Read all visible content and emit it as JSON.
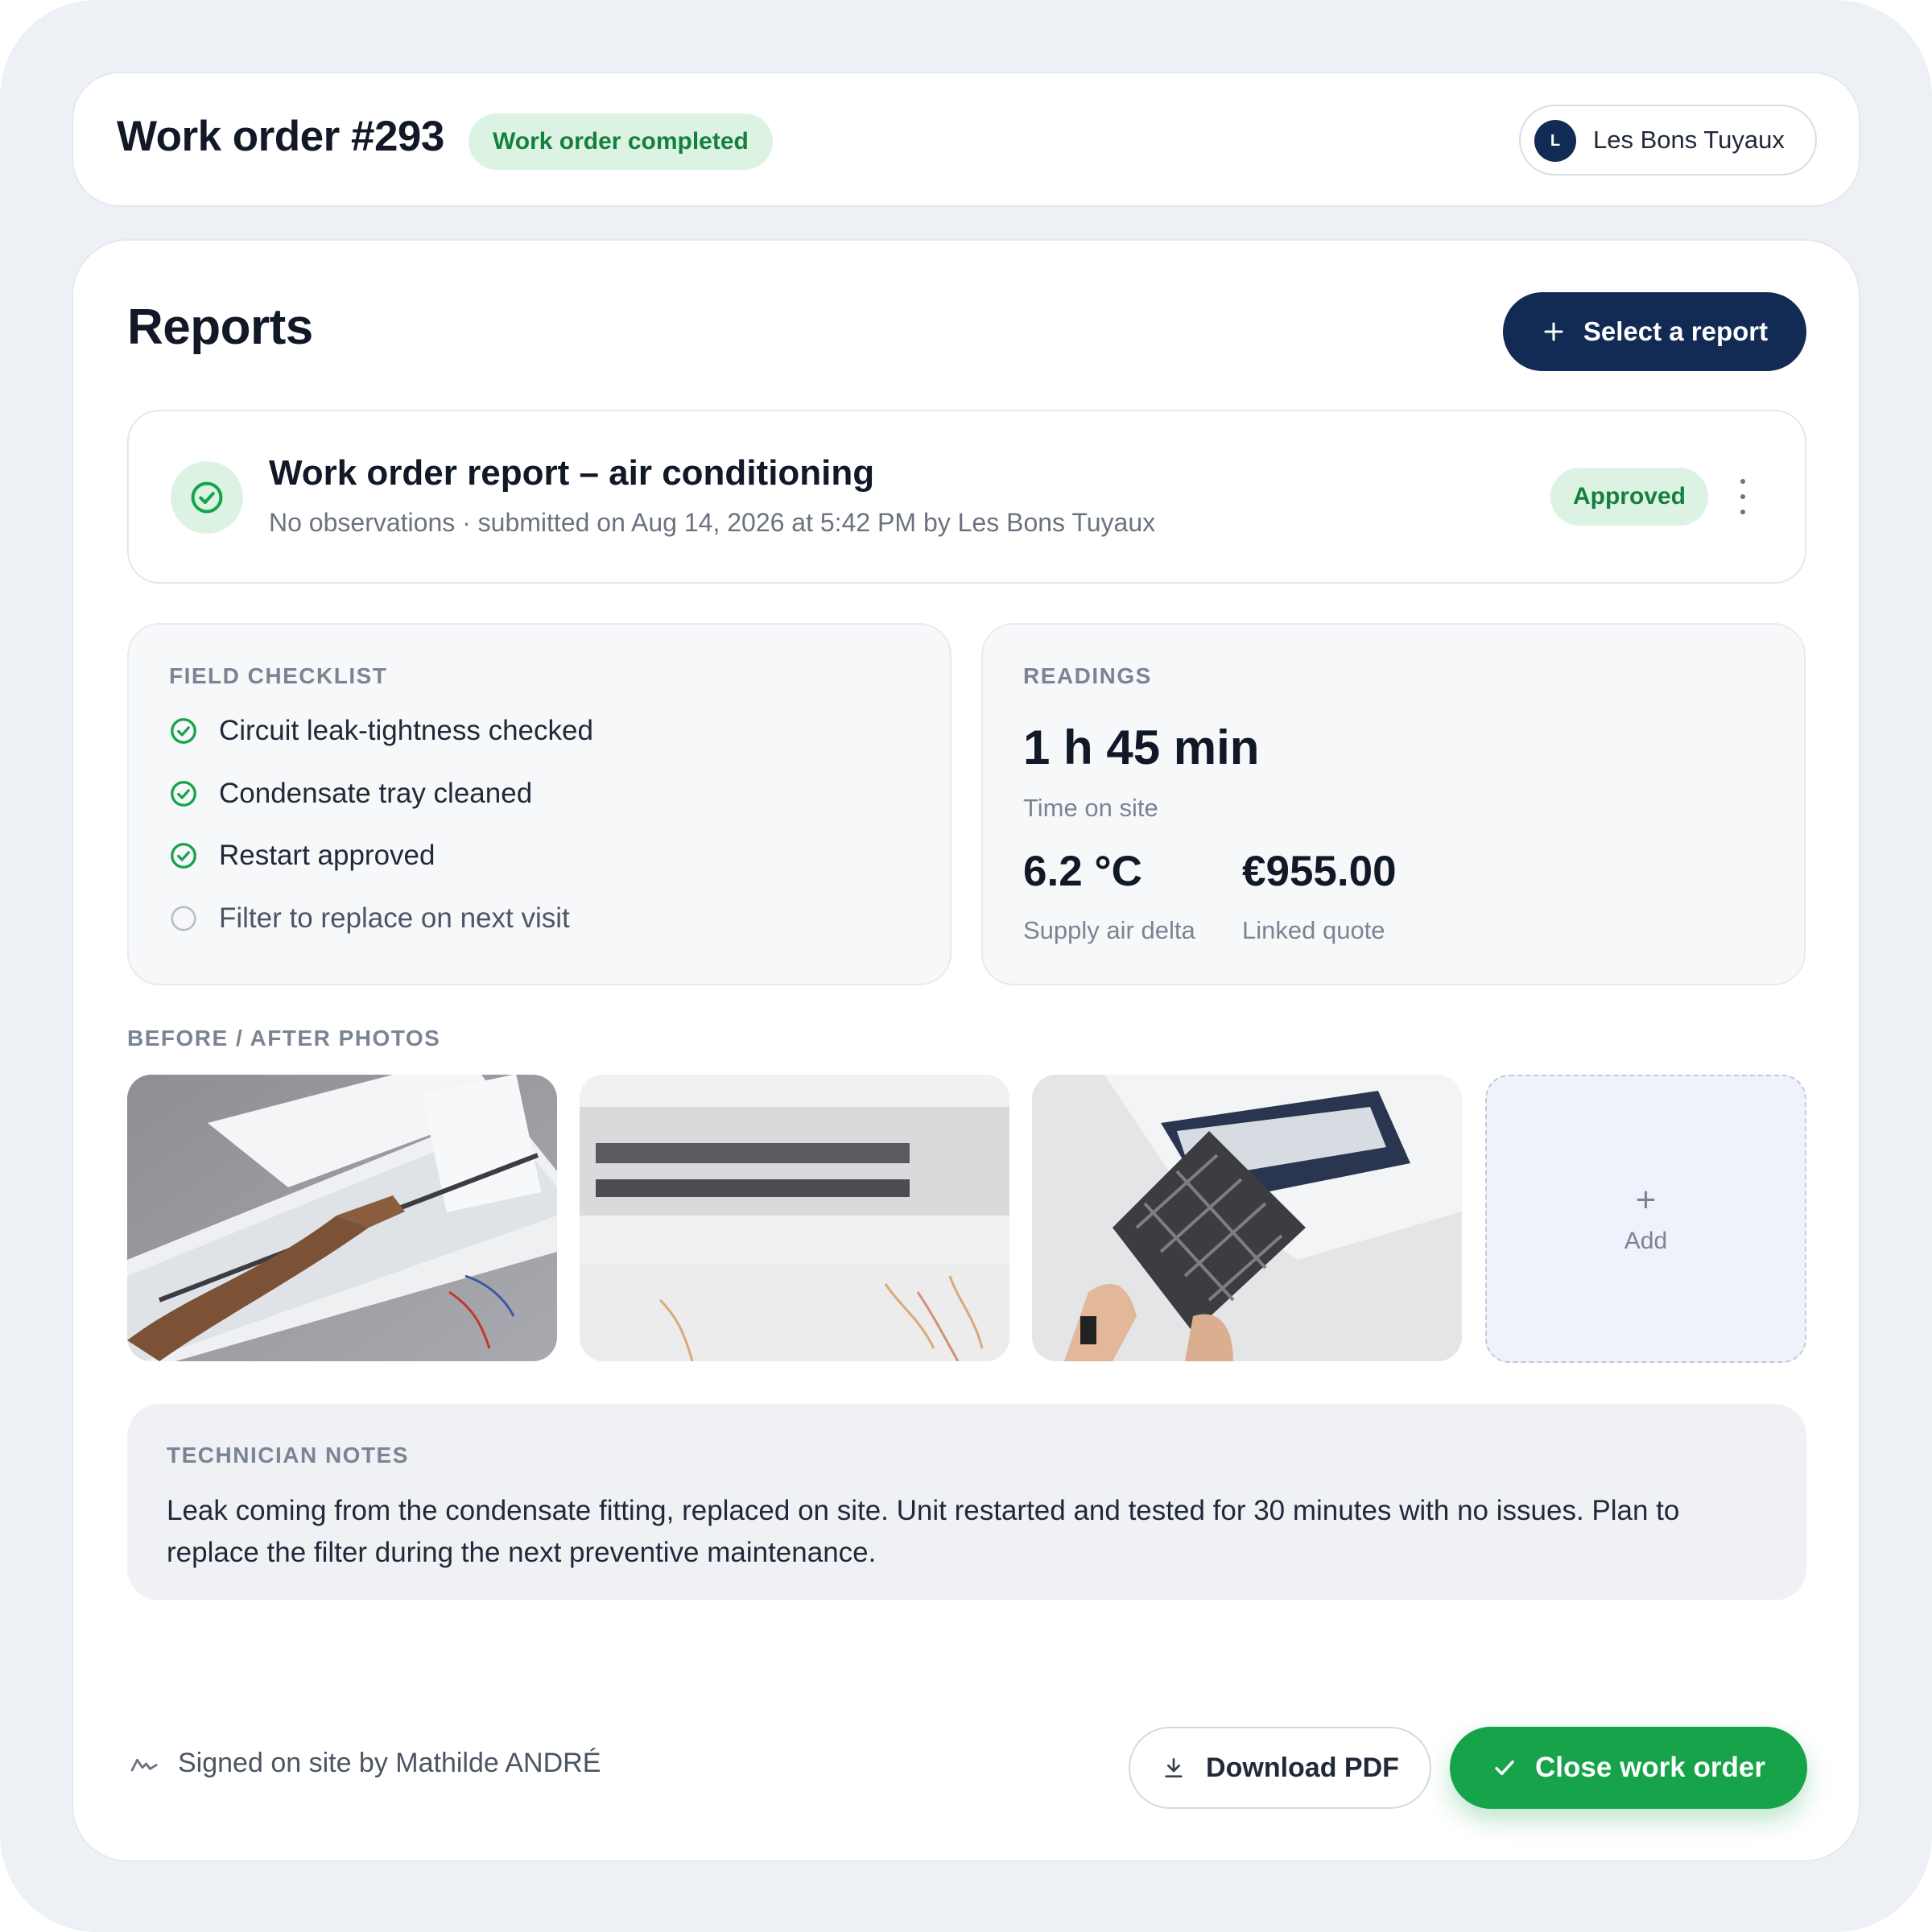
{
  "header": {
    "title": "Work order #293",
    "status": "Work order completed",
    "company_initial": "L",
    "company_name": "Les Bons Tuyaux"
  },
  "reports": {
    "title": "Reports",
    "select_button": "Select a report",
    "report": {
      "title": "Work order report – air conditioning",
      "subtitle": "No observations · submitted on Aug 14, 2026 at 5:42 PM by Les Bons Tuyaux",
      "status": "Approved"
    }
  },
  "checklist": {
    "label": "FIELD CHECKLIST",
    "items": [
      {
        "label": "Circuit leak-tightness checked",
        "checked": true
      },
      {
        "label": "Condensate tray cleaned",
        "checked": true
      },
      {
        "label": "Restart approved",
        "checked": true
      },
      {
        "label": "Filter to replace on next visit",
        "checked": false
      }
    ]
  },
  "readings": {
    "label": "READINGS",
    "time_value": "1 h 45 min",
    "time_caption": "Time on site",
    "delta_value": "6.2 °C",
    "delta_caption": "Supply air delta",
    "quote_value": "€955.00",
    "quote_caption": "Linked quote"
  },
  "photos": {
    "label": "BEFORE / AFTER PHOTOS",
    "add_label": "Add",
    "add_icon": "+"
  },
  "notes": {
    "label": "TECHNICIAN NOTES",
    "text": "Leak coming from the condensate fitting, replaced on site. Unit restarted and tested for 30 minutes with no issues. Plan to replace the filter during the next preventive maintenance."
  },
  "footer": {
    "signed": "Signed on site by Mathilde ANDRÉ",
    "download_button": "Download PDF",
    "close_button": "Close work order"
  },
  "colors": {
    "primary_navy": "#112b55",
    "success_green": "#16a34a",
    "success_text": "#15803d",
    "success_bg": "#dcf3e4"
  },
  "icons": {
    "report_status": "check-circle-icon",
    "select": "plus-icon",
    "menu": "kebab-menu-icon",
    "download": "download-icon",
    "close": "check-icon",
    "signature": "signature-icon"
  }
}
